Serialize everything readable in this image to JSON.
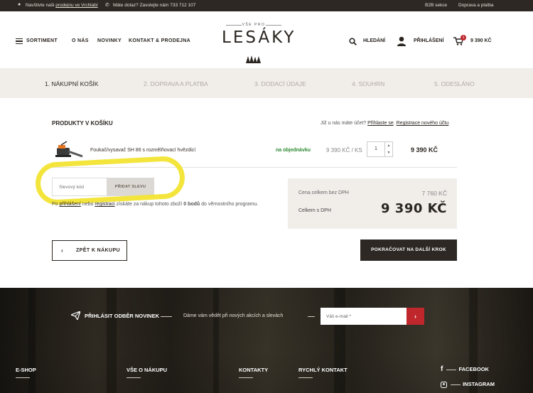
{
  "topbar": {
    "visit_prefix": "Navštivte naši ",
    "visit_link": "prodejnu ve Vrchlabí",
    "phone": "Máte dotaz? Zavolejte nám 733 712 107",
    "b2b": "B2B sekce",
    "shipping": "Doprava a platba"
  },
  "header": {
    "menu": "SORTIMENT",
    "nav": [
      "O NÁS",
      "NOVINKY",
      "KONTAKT & PRODEJNA"
    ],
    "logo_tagline": "VŠE PRO",
    "logo_name": "LESÁKY",
    "search": "HLEDÁNÍ",
    "login": "PŘIHLÁŠENÍ",
    "cart_count": "1",
    "cart_total": "9 390 KČ"
  },
  "steps": [
    "1. NÁKUPNÍ KOŠÍK",
    "2. DOPRAVA A PLATBA",
    "3. DODACÍ ÚDAJE",
    "4. SOUHRN",
    "5. ODESLÁNO"
  ],
  "cart": {
    "heading": "PRODUKTY V KOŠÍKU",
    "account_question": "Již u nás máte účet? ",
    "login_link": "Přihlaste se",
    "reg_link": "Registrace nového účtu",
    "item": {
      "name": "Foukač/vysavač SH 86 s rozmělňovací hvězdicí",
      "availability": "na objednávku",
      "unit_price": "9 390 KČ / KS",
      "qty": "1",
      "total": "9 390 KČ"
    },
    "coupon_placeholder": "Slevový kód",
    "coupon_button": "PŘIDAT SLEVU",
    "note_prefix": "Po ",
    "note_login": "přihlášení",
    "note_mid": " nebo ",
    "note_reg": "registraci",
    "note_text1": " získáte za nákup tohoto zboží ",
    "note_points": "0 bodů",
    "note_text2": " do věrnostního programu.",
    "sum_net_label": "Cena celkem bez DPH",
    "sum_net_value": "7 760 KČ",
    "sum_gross_label": "Celkem s DPH",
    "sum_gross_value": "9 390 KČ",
    "back_button": "ZPĚT K NÁKUPU",
    "continue_button": "POKRAČOVAT NA DALŠÍ KROK"
  },
  "footer": {
    "newsletter_title": "PŘIHLÁSIT ODBĚR NOVINEK",
    "newsletter_text": "Dáme vám vědět při nových akcích a slevách",
    "email_placeholder": "Váš e-mail *",
    "columns": [
      "E-SHOP",
      "VŠE O NÁKUPU",
      "KONTAKTY",
      "RYCHLÝ KONTAKT"
    ],
    "facebook": "FACEBOOK",
    "instagram": "INSTAGRAM"
  },
  "colors": {
    "dark": "#2d2823",
    "accent_red": "#c0272d",
    "highlight": "#f2e32a",
    "available": "#2f8a32"
  }
}
